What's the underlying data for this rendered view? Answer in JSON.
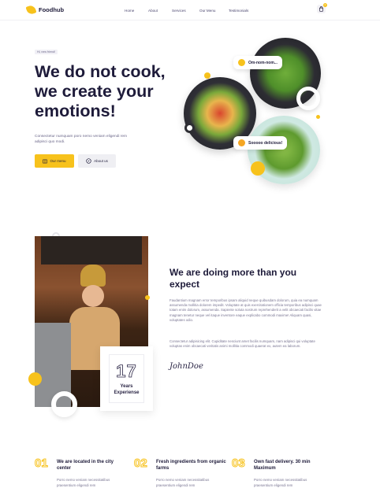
{
  "nav": {
    "logo_text": "Foodhub",
    "items": [
      {
        "label": "Home"
      },
      {
        "label": "About"
      },
      {
        "label": "Services"
      },
      {
        "label": "Our Menu"
      },
      {
        "label": "Testimonials"
      }
    ],
    "cart_count": "0"
  },
  "hero": {
    "tag": "Hi, new friend!",
    "title": "We do not cook, we create your emotions!",
    "subtitle": "Consectetur numquam poro nemo veniam eligendi rem adipisci quo modi.",
    "primary_button": "Our menu",
    "secondary_button": "About us",
    "bubble_top": "Om-nom-nom...",
    "bubble_bottom": "Sooooo delicious!"
  },
  "about": {
    "title": "We are doing more than you expect",
    "paragraph1": "Faudantium magnam error temporibus ipsam aliquid neque quibusdam dolorum, quia ea numquam assumenda mollitia dolorem impedit. Voluptate at quis exercitationem officia temporibus adipisci quae totam enim dolorum, assumenda. Sapiente soluta nostrum reprehenderit a velit obcaecati facilis vitae magnam tenetur neque vel itaque inventore eaque explicabo commodi maxime! Aliquam quasi, voluptates odio.",
    "paragraph2": "Consectetur adipisicing elit. Cupiditate nesciunt amet facilis numquam, nam adipisci qui voluptate voluptas enim obcaecati veritatis animi mollitia commodi quaerat ex, autem ea laborum.",
    "signature": "JohnDoe",
    "stat_number": "17",
    "stat_label": "Years Experiense"
  },
  "features": [
    {
      "num": "01",
      "title": "We are located in the city center",
      "text": "Porro nemo veniam necessitatibus praesentium eligendi rem"
    },
    {
      "num": "02",
      "title": "Fresh ingredients from organic farms",
      "text": "Porro nemo veniam necessitatibus praesentium eligendi rem"
    },
    {
      "num": "03",
      "title": "Own fast delivery. 30 min Maximum",
      "text": "Porro nemo veniam necessitatibus praesentium eligendi rem"
    }
  ],
  "colors": {
    "accent": "#f7c21c",
    "text_dark": "#1e1b3a",
    "text_muted": "#7a7693"
  }
}
